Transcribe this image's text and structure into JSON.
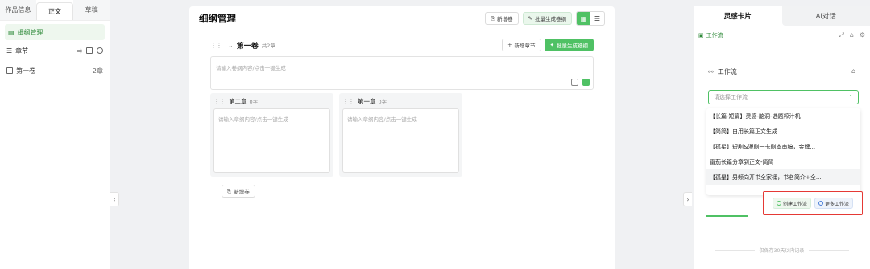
{
  "left": {
    "tabs": [
      "作品信息",
      "正文",
      "草稿"
    ],
    "outline_label": "细纲管理",
    "chapters_label": "章节",
    "volume_item": "第一卷",
    "volume_count": "2章"
  },
  "center": {
    "title": "细纲管理",
    "new_volume_btn": "新增卷",
    "batch_gen_btn": "批量生成卷纲",
    "volume": {
      "title": "第一卷",
      "count": "共2章",
      "add_chapter_btn": "新增章节",
      "batch_gen_btn": "批量生成细纲",
      "placeholder": "请输入卷纲内容/点击一键生成"
    },
    "chapters": [
      {
        "title": "第二章",
        "words": "0字",
        "placeholder": "请输入章纲内容/点击一键生成"
      },
      {
        "title": "第一章",
        "words": "0字",
        "placeholder": "请输入章纲内容/点击一键生成"
      }
    ],
    "add_volume_btn": "新增卷"
  },
  "right": {
    "tabs": [
      "灵感卡片",
      "AI对话"
    ],
    "sub_label": "工作流",
    "section_title": "工作流",
    "select_placeholder": "请选择工作流",
    "options": [
      "【长篇-短篇】灵感-脑洞-选题榨汁机",
      "【简简】自用长篇正文生成",
      "【孤星】短剧&漫剧一卡剧本审稿，金牌...",
      "番茄长篇分章到正文-简简",
      "【孤星】男频向开书全家桶，书名简介+全..."
    ],
    "create_btn": "创建工作流",
    "more_btn": "更多工作流",
    "footer": "仅保存30天以内记录"
  },
  "colors": {
    "accent": "#4fc164",
    "highlight_border": "#e53935"
  }
}
